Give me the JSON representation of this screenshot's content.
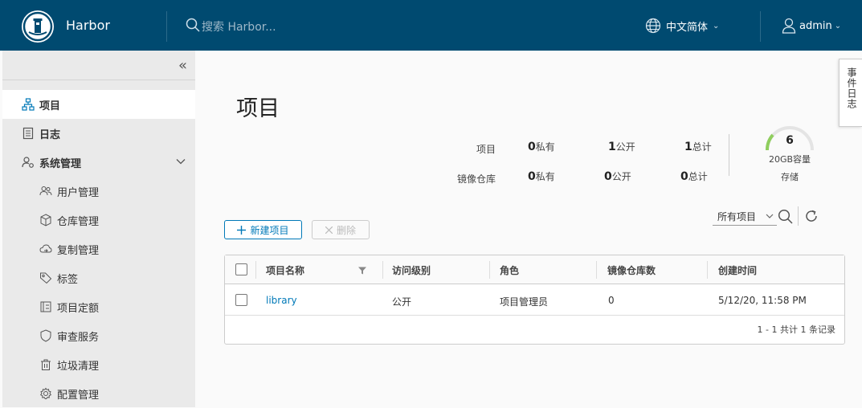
{
  "header": {
    "brand": "Harbor",
    "search_placeholder": "搜索 Harbor...",
    "language": "中文简体",
    "user": "admin",
    "bg_color": "#004a70"
  },
  "sidebar": {
    "items": [
      {
        "label": "项目",
        "icon": "projects-icon",
        "active": true
      },
      {
        "label": "日志",
        "icon": "logs-icon"
      },
      {
        "label": "系统管理",
        "icon": "system-admin-icon",
        "expanded": true
      }
    ],
    "sub_items": [
      {
        "label": "用户管理",
        "icon": "users-icon"
      },
      {
        "label": "仓库管理",
        "icon": "registry-icon"
      },
      {
        "label": "复制管理",
        "icon": "replication-icon"
      },
      {
        "label": "标签",
        "icon": "tag-icon"
      },
      {
        "label": "项目定额",
        "icon": "quota-icon"
      },
      {
        "label": "审查服务",
        "icon": "shield-icon"
      },
      {
        "label": "垃圾清理",
        "icon": "trash-icon"
      },
      {
        "label": "配置管理",
        "icon": "gear-icon"
      }
    ]
  },
  "main": {
    "title": "项目",
    "stats": {
      "projects_label": "项目",
      "repos_label": "镜像仓库",
      "private_suffix": "私有",
      "public_suffix": "公开",
      "total_suffix": "总计",
      "projects_private": "0",
      "projects_public": "1",
      "projects_total": "1",
      "repos_private": "0",
      "repos_public": "0",
      "repos_total": "0"
    },
    "storage": {
      "value": "6",
      "capacity": "20GB容量",
      "label": "存储",
      "accent": "#8fce5e"
    },
    "buttons": {
      "new_project": "新建项目",
      "delete": "删除"
    },
    "filter": {
      "selected": "所有项目"
    },
    "table": {
      "columns": [
        "项目名称",
        "访问级别",
        "角色",
        "镜像仓库数",
        "创建时间"
      ],
      "rows": [
        {
          "name": "library",
          "access": "公开",
          "role": "项目管理员",
          "repo_count": "0",
          "created": "5/12/20, 11:58 PM"
        }
      ],
      "footer": "1 - 1 共计 1 条记录"
    }
  },
  "event_log_tab": "事件日志"
}
